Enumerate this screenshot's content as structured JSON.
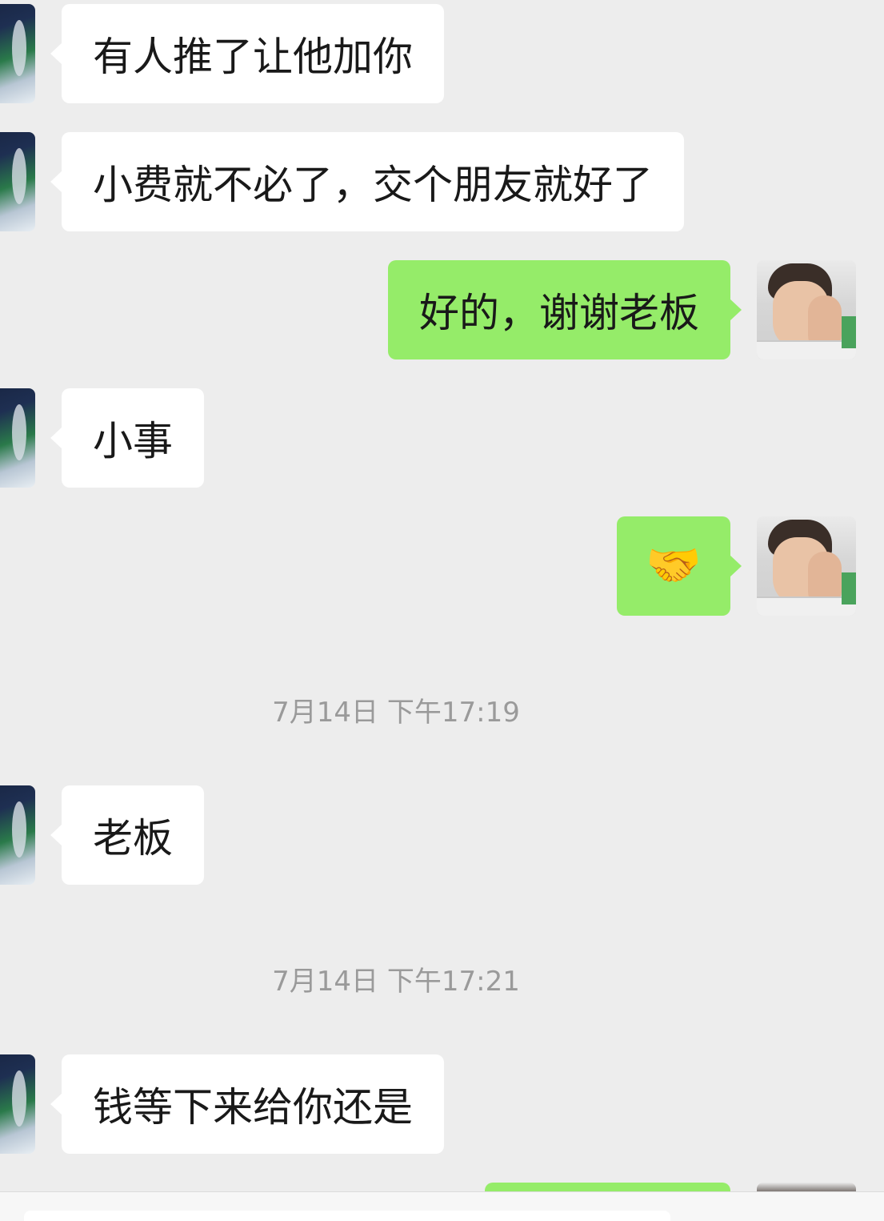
{
  "chat": {
    "messages": [
      {
        "sender": "other",
        "text": "有人推了让他加你"
      },
      {
        "sender": "other",
        "text": "小费就不必了，交个朋友就好了"
      },
      {
        "sender": "self",
        "text": "好的，谢谢老板"
      },
      {
        "sender": "other",
        "text": "小事"
      },
      {
        "sender": "self",
        "text": "🤝",
        "icon": "handshake-emoji"
      },
      {
        "type": "timestamp",
        "text": "7月14日 下午17:19"
      },
      {
        "sender": "other",
        "text": "老板"
      },
      {
        "type": "timestamp",
        "text": "7月14日 下午17:21"
      },
      {
        "sender": "other",
        "text": "钱等下来给你还是"
      }
    ]
  },
  "colors": {
    "background": "#ededed",
    "incoming_bubble": "#ffffff",
    "outgoing_bubble": "#95ec69",
    "timestamp_text": "#9a9a9a"
  }
}
